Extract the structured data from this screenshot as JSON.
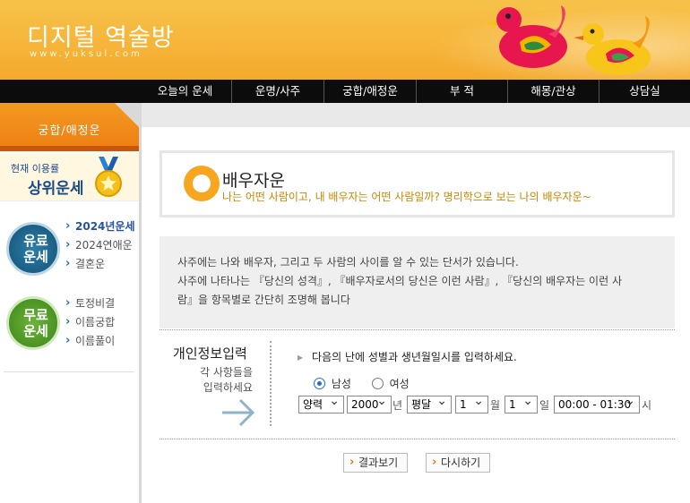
{
  "header": {
    "logo_title": "디지털 역술방",
    "logo_sub": "www.yuksul.com"
  },
  "nav": [
    "오늘의 운세",
    "운명/사주",
    "궁합/애정운",
    "부 적",
    "해몽/관상",
    "상담실"
  ],
  "sidebar": {
    "section_title": "궁합/애정운",
    "rank_small": "현재 이용률",
    "rank_big": "상위운세",
    "paid_badge": [
      "유료",
      "운세"
    ],
    "paid_items": [
      "2024년운세",
      "2024연애운",
      "결혼운"
    ],
    "free_badge": [
      "무료",
      "운세"
    ],
    "free_items": [
      "토정비결",
      "이름궁합",
      "이름풀이"
    ]
  },
  "title": {
    "main": "배우자운",
    "sub": "나는 어떤 사람이고, 내 배우자는 어떤 사람일까? 명리학으로 보는 나의 배우자운~"
  },
  "description": {
    "line1": "사주에는 나와 배우자, 그리고 두 사람의 사이를 알 수 있는 단서가 있습니다.",
    "line2": "사주에 나타나는 『당신의 성격』, 『배우자로서의 당신은 이런 사람』, 『당신의 배우자는 이런 사",
    "line3": "람』을 항목별로 간단히 조명해 봅니다"
  },
  "form": {
    "title": "개인정보입력",
    "sub1": "각 사항들을",
    "sub2": "입력하세요",
    "guide": "다음의 난에 성별과 생년월일시를 입력하세요.",
    "gender_male": "남성",
    "gender_female": "여성",
    "calendar": "양력",
    "year": "2000",
    "year_unit": "년",
    "leap": "평달",
    "month": "1",
    "month_unit": "월",
    "day": "1",
    "day_unit": "일",
    "time": "00:00 - 01:30",
    "time_unit": "시",
    "submit": "결과보기",
    "reset": "다시하기"
  }
}
